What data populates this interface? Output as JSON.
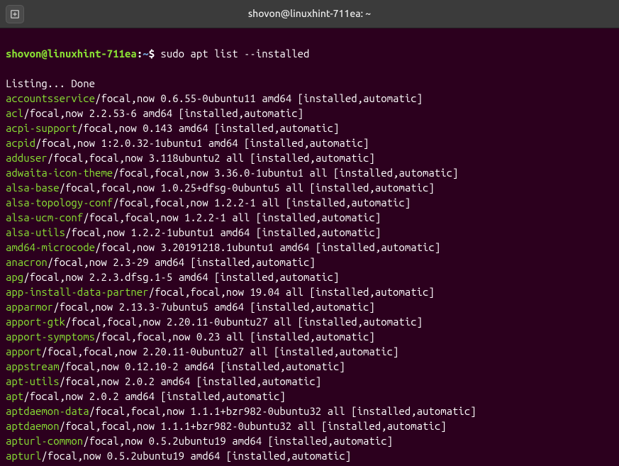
{
  "window": {
    "title": "shovon@linuxhint-711ea: ~"
  },
  "prompt": {
    "user_host": "shovon@linuxhint-711ea",
    "colon": ":",
    "path": "~",
    "dollar": "$"
  },
  "command": " sudo apt list --installed",
  "listing": "Listing... Done",
  "packages": [
    {
      "name": "accountsservice",
      "rest": "/focal,now 0.6.55-0ubuntu11 amd64 [installed,automatic]"
    },
    {
      "name": "acl",
      "rest": "/focal,now 2.2.53-6 amd64 [installed,automatic]"
    },
    {
      "name": "acpi-support",
      "rest": "/focal,now 0.143 amd64 [installed,automatic]"
    },
    {
      "name": "acpid",
      "rest": "/focal,now 1:2.0.32-1ubuntu1 amd64 [installed,automatic]"
    },
    {
      "name": "adduser",
      "rest": "/focal,focal,now 3.118ubuntu2 all [installed,automatic]"
    },
    {
      "name": "adwaita-icon-theme",
      "rest": "/focal,focal,now 3.36.0-1ubuntu1 all [installed,automatic]"
    },
    {
      "name": "alsa-base",
      "rest": "/focal,focal,now 1.0.25+dfsg-0ubuntu5 all [installed,automatic]"
    },
    {
      "name": "alsa-topology-conf",
      "rest": "/focal,focal,now 1.2.2-1 all [installed,automatic]"
    },
    {
      "name": "alsa-ucm-conf",
      "rest": "/focal,focal,now 1.2.2-1 all [installed,automatic]"
    },
    {
      "name": "alsa-utils",
      "rest": "/focal,now 1.2.2-1ubuntu1 amd64 [installed,automatic]"
    },
    {
      "name": "amd64-microcode",
      "rest": "/focal,now 3.20191218.1ubuntu1 amd64 [installed,automatic]"
    },
    {
      "name": "anacron",
      "rest": "/focal,now 2.3-29 amd64 [installed,automatic]"
    },
    {
      "name": "apg",
      "rest": "/focal,now 2.2.3.dfsg.1-5 amd64 [installed,automatic]"
    },
    {
      "name": "app-install-data-partner",
      "rest": "/focal,focal,now 19.04 all [installed,automatic]"
    },
    {
      "name": "apparmor",
      "rest": "/focal,now 2.13.3-7ubuntu5 amd64 [installed,automatic]"
    },
    {
      "name": "apport-gtk",
      "rest": "/focal,focal,now 2.20.11-0ubuntu27 all [installed,automatic]"
    },
    {
      "name": "apport-symptoms",
      "rest": "/focal,focal,now 0.23 all [installed,automatic]"
    },
    {
      "name": "apport",
      "rest": "/focal,focal,now 2.20.11-0ubuntu27 all [installed,automatic]"
    },
    {
      "name": "appstream",
      "rest": "/focal,now 0.12.10-2 amd64 [installed,automatic]"
    },
    {
      "name": "apt-utils",
      "rest": "/focal,now 2.0.2 amd64 [installed,automatic]"
    },
    {
      "name": "apt",
      "rest": "/focal,now 2.0.2 amd64 [installed,automatic]"
    },
    {
      "name": "aptdaemon-data",
      "rest": "/focal,focal,now 1.1.1+bzr982-0ubuntu32 all [installed,automatic]"
    },
    {
      "name": "aptdaemon",
      "rest": "/focal,focal,now 1.1.1+bzr982-0ubuntu32 all [installed,automatic]"
    },
    {
      "name": "apturl-common",
      "rest": "/focal,now 0.5.2ubuntu19 amd64 [installed,automatic]"
    },
    {
      "name": "apturl",
      "rest": "/focal,now 0.5.2ubuntu19 amd64 [installed,automatic]"
    }
  ]
}
